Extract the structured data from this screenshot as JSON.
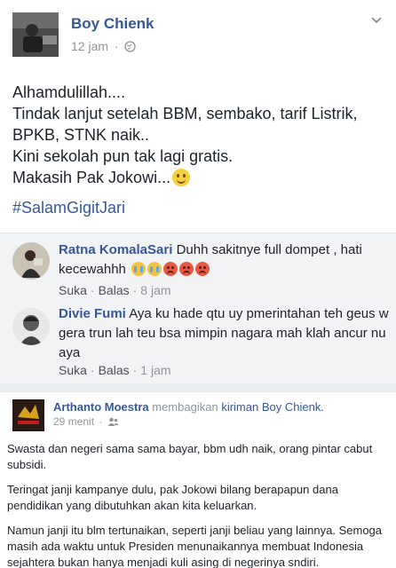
{
  "post": {
    "author": "Boy Chienk",
    "time": "12 jam",
    "privacy_icon": "globe-icon",
    "menu_icon": "chevron-down-icon",
    "lines": [
      "Alhamdulillah....",
      "Tindak lanjut setelah BBM, sembako, tarif Listrik,",
      "BPKB, STNK naik..",
      "Kini sekolah pun tak lagi gratis.",
      "Makasih Pak Jokowi..."
    ],
    "hashtag": "#SalamGigitJari"
  },
  "comments": [
    {
      "name": "Ratna KomalaSari",
      "text": "Duhh sakitnye full dompet , hati kecewahhh",
      "like": "Suka",
      "reply": "Balas",
      "time": "8 jam"
    },
    {
      "name": "Divie Fumi",
      "text": "Aya ku hade qtu uy pmerintahan teh geus w gera trun lah teu bsa mimpin nagara mah klah ancur nu aya",
      "like": "Suka",
      "reply": "Balas",
      "time": "1 jam"
    }
  ],
  "share": {
    "author": "Arthanto Moestra",
    "action": "membagikan",
    "shared_link": "kiriman Boy Chienk.",
    "time": "29 menit",
    "audience_icon": "friends-icon",
    "paragraphs": [
      "Swasta dan negeri sama sama bayar, bbm udh naik, orang pintar cabut subsidi.",
      "Teringat janji kampanye dulu, pak Jokowi bilang berapapun dana pendidikan yang dibutuhkan akan kita keluarkan.",
      "Namun janji itu blm tertunaikan, seperti janji beliau yang lainnya. Semoga masih ada waktu untuk Presiden menunaikannya membuat Indonesia sejahtera bukan hanya menjadi kuli asing di negerinya sndiri."
    ]
  },
  "colors": {
    "link": "#365899",
    "text": "#1d2129",
    "muted": "#90949c",
    "comment_bg": "#f2f3f5"
  }
}
